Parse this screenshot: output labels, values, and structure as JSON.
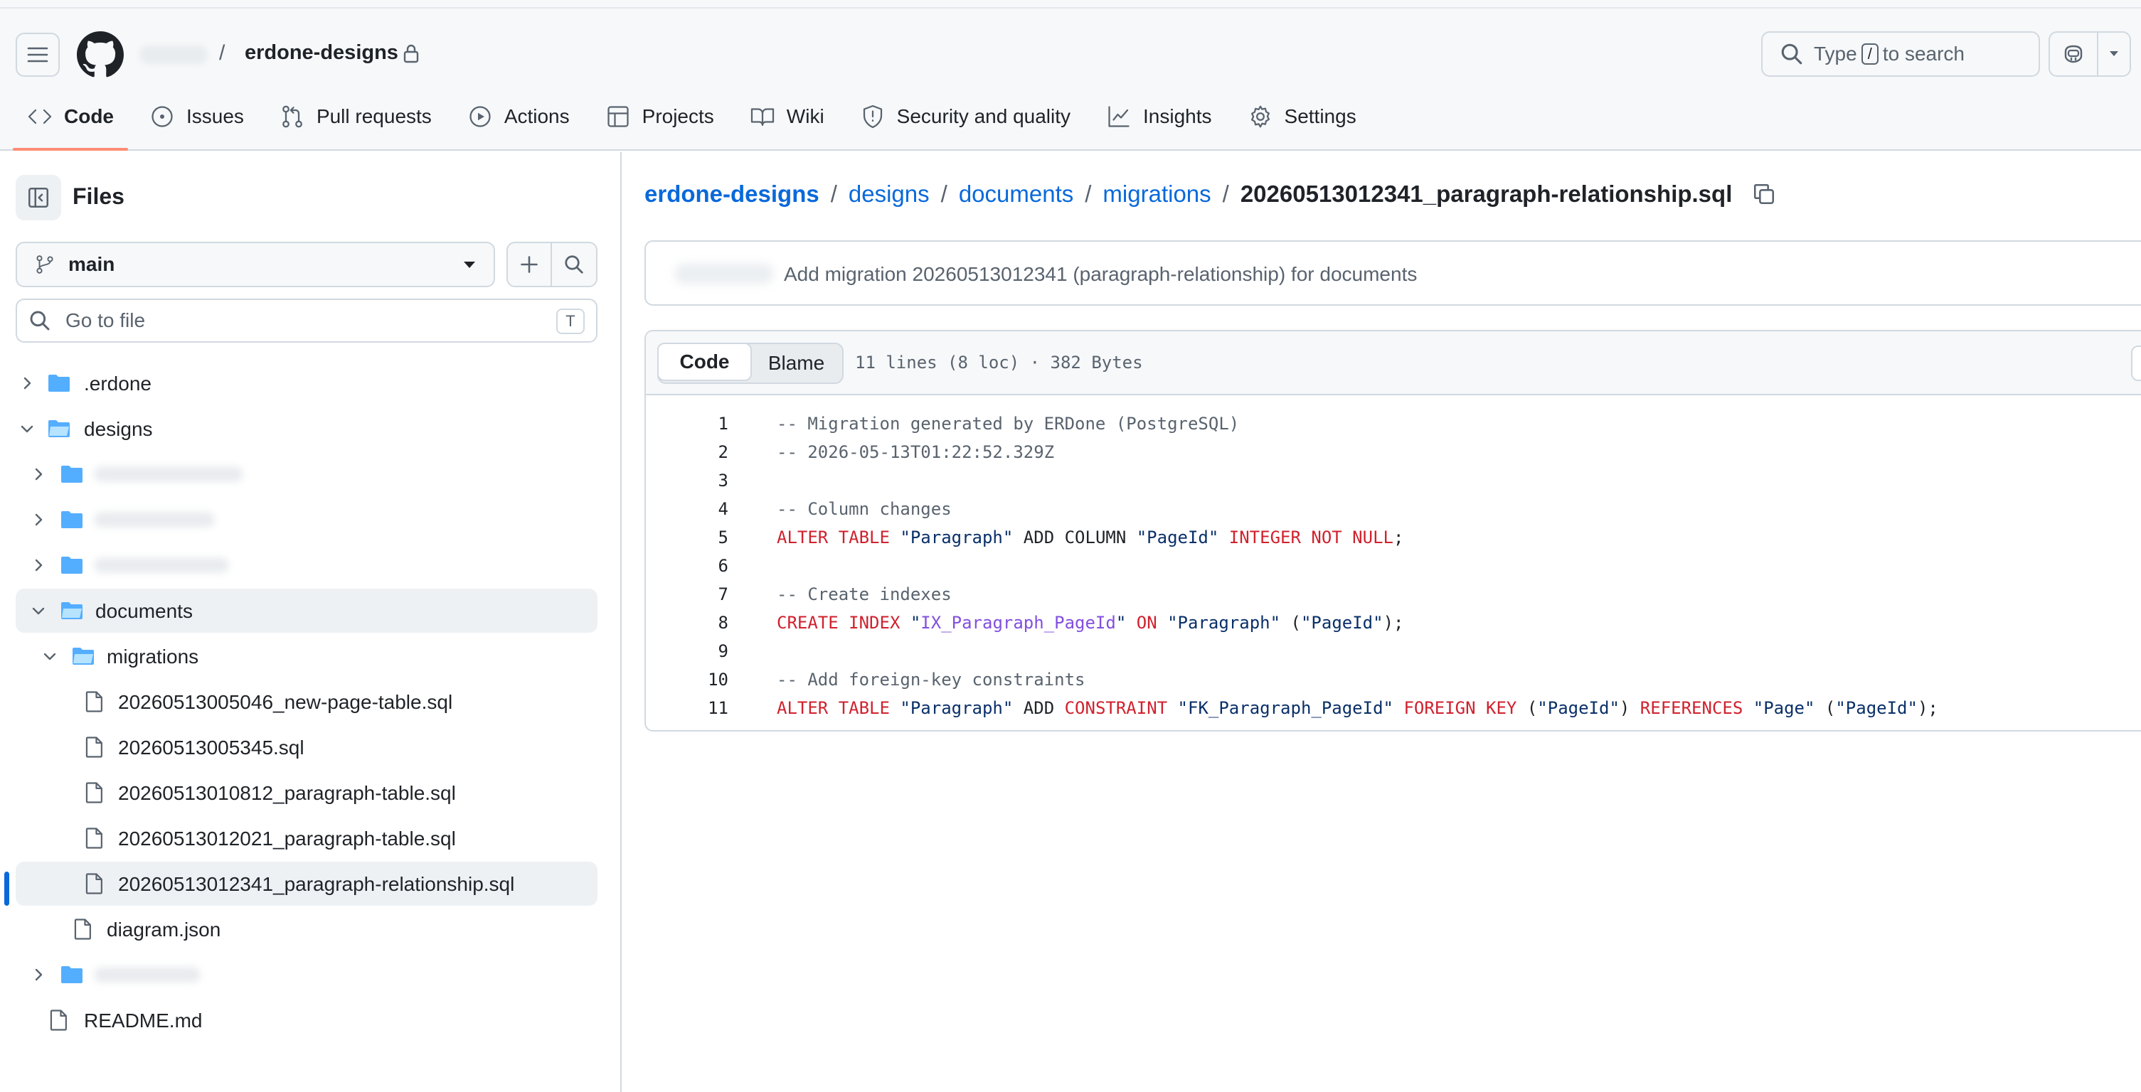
{
  "header": {
    "repo_name": "erdone-designs",
    "separator": "/",
    "search_label_pre": "Type",
    "search_key": "/",
    "search_label_post": "to search"
  },
  "nav": {
    "tabs": [
      {
        "label": "Code",
        "icon": "code-icon",
        "active": true
      },
      {
        "label": "Issues",
        "icon": "issue-icon"
      },
      {
        "label": "Pull requests",
        "icon": "pull-request-icon"
      },
      {
        "label": "Actions",
        "icon": "play-icon"
      },
      {
        "label": "Projects",
        "icon": "table-icon"
      },
      {
        "label": "Wiki",
        "icon": "book-icon"
      },
      {
        "label": "Security and quality",
        "icon": "shield-icon"
      },
      {
        "label": "Insights",
        "icon": "graph-icon"
      },
      {
        "label": "Settings",
        "icon": "gear-icon"
      }
    ]
  },
  "sidebar": {
    "title": "Files",
    "branch": "main",
    "goto_placeholder": "Go to file",
    "goto_shortcut": "T",
    "tree": [
      {
        "label": ".erdone",
        "type": "folder"
      },
      {
        "label": "designs",
        "type": "folder",
        "expanded": true
      },
      {
        "label": "documents",
        "type": "folder",
        "expanded": true
      },
      {
        "label": "migrations",
        "type": "folder",
        "expanded": true
      },
      {
        "label": "20260513005046_new-page-table.sql",
        "type": "file"
      },
      {
        "label": "20260513005345.sql",
        "type": "file"
      },
      {
        "label": "20260513010812_paragraph-table.sql",
        "type": "file"
      },
      {
        "label": "20260513012021_paragraph-table.sql",
        "type": "file"
      },
      {
        "label": "20260513012341_paragraph-relationship.sql",
        "type": "file",
        "selected": true
      },
      {
        "label": "diagram.json",
        "type": "file"
      },
      {
        "label": "README.md",
        "type": "file"
      }
    ]
  },
  "breadcrumb": {
    "root": "erdone-designs",
    "p1": "designs",
    "p2": "documents",
    "p3": "migrations",
    "current": "20260513012341_paragraph-relationship.sql",
    "sep": "/"
  },
  "commit": {
    "message": "Add migration 20260513012341 (paragraph-relationship) for documents"
  },
  "file": {
    "tab_code": "Code",
    "tab_blame": "Blame",
    "meta": "11 lines (8 loc) · 382 Bytes",
    "line_numbers": [
      "1",
      "2",
      "3",
      "4",
      "5",
      "6",
      "7",
      "8",
      "9",
      "10",
      "11"
    ],
    "lines": [
      [
        {
          "t": "cm",
          "v": "-- Migration generated by ERDone (PostgreSQL)"
        }
      ],
      [
        {
          "t": "cm",
          "v": "-- 2026-05-13T01:22:52.329Z"
        }
      ],
      [],
      [
        {
          "t": "cm",
          "v": "-- Column changes"
        }
      ],
      [
        {
          "t": "kw",
          "v": "ALTER TABLE "
        },
        {
          "t": "st",
          "v": "\"Paragraph\""
        },
        {
          "t": "pl",
          "v": " ADD COLUMN "
        },
        {
          "t": "st",
          "v": "\"PageId\""
        },
        {
          "t": "pl",
          "v": " "
        },
        {
          "t": "kw",
          "v": "INTEGER NOT NULL"
        },
        {
          "t": "pl",
          "v": ";"
        }
      ],
      [],
      [
        {
          "t": "cm",
          "v": "-- Create indexes"
        }
      ],
      [
        {
          "t": "kw",
          "v": "CREATE INDEX "
        },
        {
          "t": "st",
          "v": "\""
        },
        {
          "t": "pu",
          "v": "IX_Paragraph_PageId"
        },
        {
          "t": "st",
          "v": "\""
        },
        {
          "t": "pl",
          "v": " "
        },
        {
          "t": "kw",
          "v": "ON"
        },
        {
          "t": "pl",
          "v": " "
        },
        {
          "t": "st",
          "v": "\"Paragraph\""
        },
        {
          "t": "pl",
          "v": " ("
        },
        {
          "t": "st",
          "v": "\"PageId\""
        },
        {
          "t": "pl",
          "v": ");"
        }
      ],
      [],
      [
        {
          "t": "cm",
          "v": "-- Add foreign-key constraints"
        }
      ],
      [
        {
          "t": "kw",
          "v": "ALTER TABLE "
        },
        {
          "t": "st",
          "v": "\"Paragraph\""
        },
        {
          "t": "pl",
          "v": " ADD "
        },
        {
          "t": "kw",
          "v": "CONSTRAINT"
        },
        {
          "t": "pl",
          "v": " "
        },
        {
          "t": "st",
          "v": "\"FK_Paragraph_PageId\""
        },
        {
          "t": "pl",
          "v": " "
        },
        {
          "t": "kw",
          "v": "FOREIGN KEY"
        },
        {
          "t": "pl",
          "v": " ("
        },
        {
          "t": "st",
          "v": "\"PageId\""
        },
        {
          "t": "pl",
          "v": ") "
        },
        {
          "t": "kw",
          "v": "REFERENCES"
        },
        {
          "t": "pl",
          "v": " "
        },
        {
          "t": "st",
          "v": "\"Page\""
        },
        {
          "t": "pl",
          "v": " ("
        },
        {
          "t": "st",
          "v": "\"PageId\""
        },
        {
          "t": "pl",
          "v": ");"
        }
      ]
    ]
  },
  "colors": {
    "link": "#0969da",
    "tab_underline": "#fd8c73",
    "folder": "#54aeff",
    "keyword": "#cf222e",
    "string": "#0a3069",
    "entity": "#8250df",
    "comment": "#59636e"
  }
}
